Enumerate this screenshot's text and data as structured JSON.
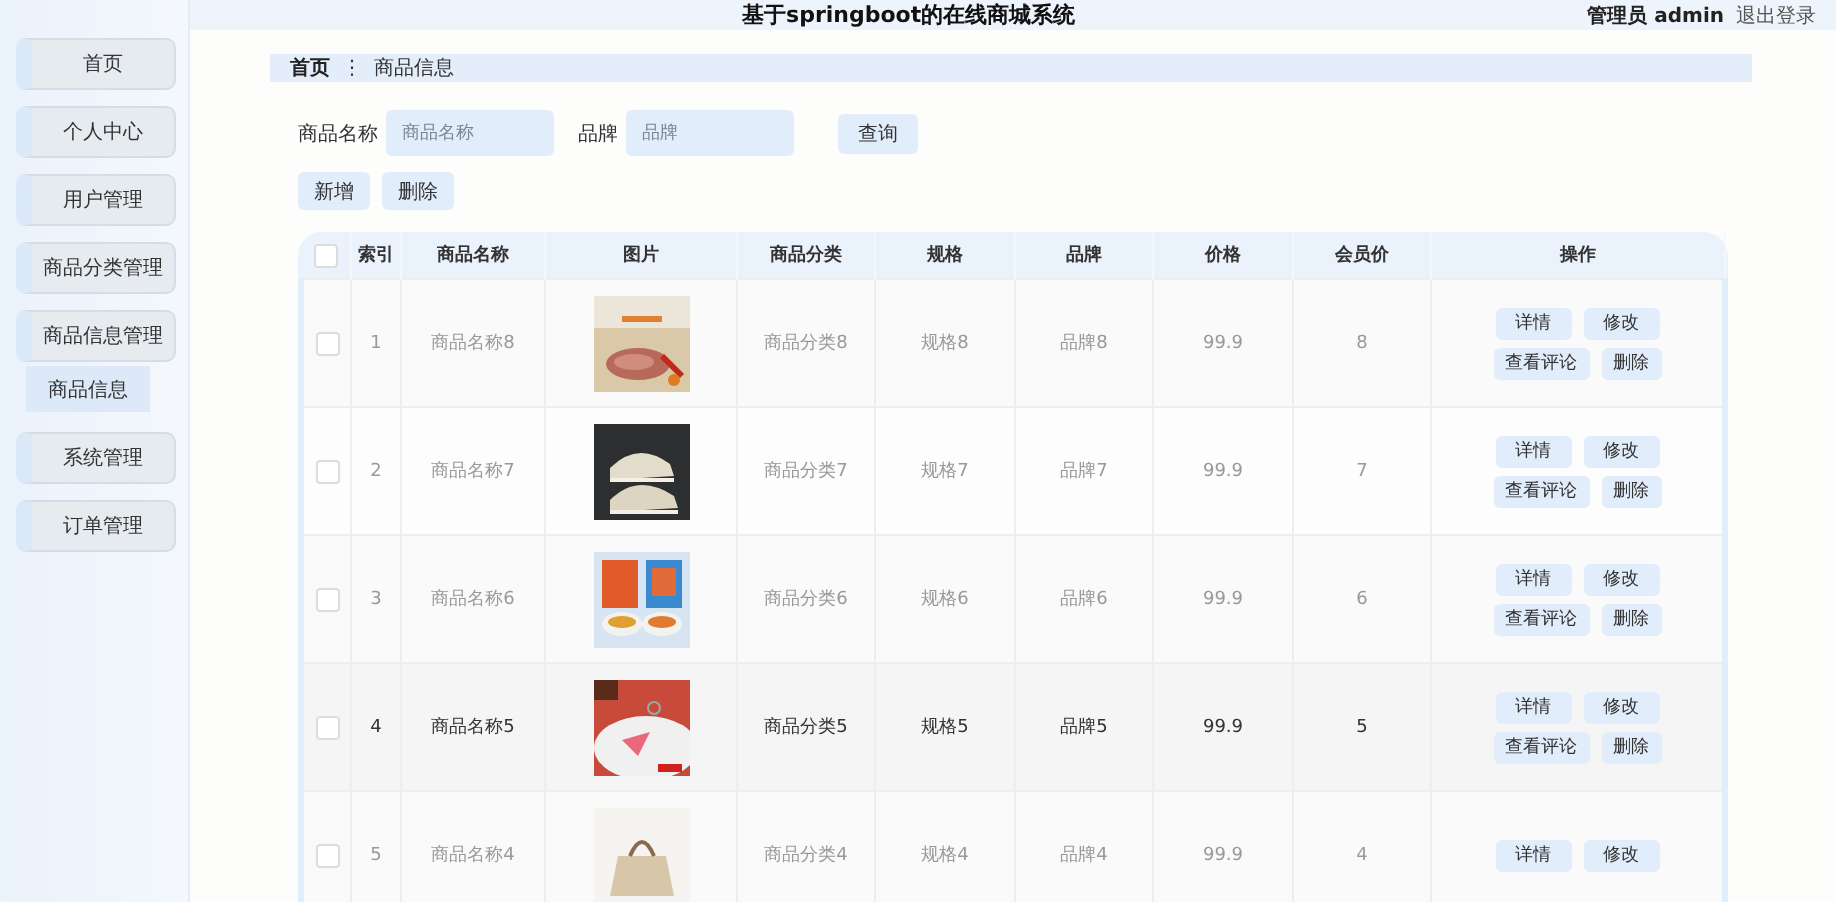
{
  "sidebar": {
    "items": [
      {
        "label": "首页",
        "selected": false
      },
      {
        "label": "个人中心",
        "selected": false
      },
      {
        "label": "用户管理",
        "selected": false
      },
      {
        "label": "商品分类管理",
        "selected": false
      },
      {
        "label": "商品信息管理",
        "selected": false,
        "children": [
          {
            "label": "商品信息",
            "selected": true
          }
        ]
      },
      {
        "label": "系统管理",
        "selected": false
      },
      {
        "label": "订单管理",
        "selected": false
      }
    ]
  },
  "header": {
    "title": "基于springboot的在线商城系统",
    "user": "管理员 admin",
    "logout": "退出登录"
  },
  "breadcrumb": [
    "首页",
    "商品信息"
  ],
  "breadcrumb_separator": "⋮",
  "search": {
    "fields": [
      {
        "label": "商品名称",
        "placeholder": "商品名称"
      },
      {
        "label": "品牌",
        "placeholder": "品牌"
      }
    ],
    "button": "查询"
  },
  "toolbar": [
    "新增",
    "删除"
  ],
  "select_all": {
    "checked": false
  },
  "table": {
    "columns": [
      "索引",
      "商品名称",
      "图片",
      "商品分类",
      "规格",
      "品牌",
      "价格",
      "会员价",
      "操作"
    ],
    "rows": [
      {
        "checked": false,
        "highlighted": false,
        "cells": [
          {
            "text": "1"
          },
          {
            "text": "商品名称8"
          },
          {
            "kind": "picture"
          },
          {
            "text": "商品分类8"
          },
          {
            "text": "规格8"
          },
          {
            "text": "品牌8"
          },
          {
            "text": "99.9"
          },
          {
            "text": "8"
          }
        ],
        "actions": [
          "详情",
          "修改",
          "查看评论",
          "删除"
        ]
      },
      {
        "checked": false,
        "highlighted": false,
        "cells": [
          {
            "text": "2"
          },
          {
            "text": "商品名称7"
          },
          {
            "kind": "picture"
          },
          {
            "text": "商品分类7"
          },
          {
            "text": "规格7"
          },
          {
            "text": "品牌7"
          },
          {
            "text": "99.9"
          },
          {
            "text": "7"
          }
        ],
        "actions": [
          "详情",
          "修改",
          "查看评论",
          "删除"
        ]
      },
      {
        "checked": false,
        "highlighted": false,
        "cells": [
          {
            "text": "3"
          },
          {
            "text": "商品名称6"
          },
          {
            "kind": "picture"
          },
          {
            "text": "商品分类6"
          },
          {
            "text": "规格6"
          },
          {
            "text": "品牌6"
          },
          {
            "text": "99.9"
          },
          {
            "text": "6"
          }
        ],
        "actions": [
          "详情",
          "修改",
          "查看评论",
          "删除"
        ]
      },
      {
        "checked": false,
        "highlighted": true,
        "cells": [
          {
            "text": "4"
          },
          {
            "text": "商品名称5"
          },
          {
            "kind": "picture"
          },
          {
            "text": "商品分类5"
          },
          {
            "text": "规格5"
          },
          {
            "text": "品牌5"
          },
          {
            "text": "99.9"
          },
          {
            "text": "5"
          }
        ],
        "actions": [
          "详情",
          "修改",
          "查看评论",
          "删除"
        ]
      },
      {
        "checked": false,
        "highlighted": false,
        "cells": [
          {
            "text": "5"
          },
          {
            "text": "商品名称4"
          },
          {
            "kind": "picture"
          },
          {
            "text": "商品分类4"
          },
          {
            "text": "规格4"
          },
          {
            "text": "品牌4"
          },
          {
            "text": "99.9"
          },
          {
            "text": "4"
          }
        ],
        "actions": [
          "详情",
          "修改"
        ]
      }
    ]
  }
}
